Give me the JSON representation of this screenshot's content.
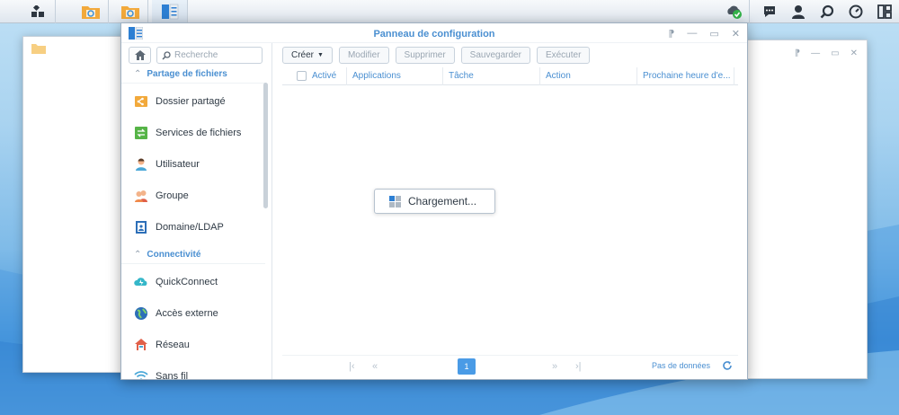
{
  "window": {
    "title": "Panneau de configuration"
  },
  "sidebar": {
    "search_placeholder": "Recherche",
    "sections": [
      {
        "label": "Partage de fichiers"
      },
      {
        "label": "Connectivité"
      }
    ],
    "items": [
      {
        "label": "Dossier partagé",
        "icon": "shared-folder-icon"
      },
      {
        "label": "Services de fichiers",
        "icon": "file-services-icon"
      },
      {
        "label": "Utilisateur",
        "icon": "user-icon"
      },
      {
        "label": "Groupe",
        "icon": "group-icon"
      },
      {
        "label": "Domaine/LDAP",
        "icon": "domain-ldap-icon"
      },
      {
        "label": "QuickConnect",
        "icon": "quickconnect-icon"
      },
      {
        "label": "Accès externe",
        "icon": "external-access-icon"
      },
      {
        "label": "Réseau",
        "icon": "network-icon"
      },
      {
        "label": "Sans fil",
        "icon": "wireless-icon"
      }
    ]
  },
  "toolbar": {
    "create": "Créer",
    "modify": "Modifier",
    "delete": "Supprimer",
    "save": "Sauvegarder",
    "run": "Exécuter"
  },
  "grid": {
    "columns": [
      "Activé",
      "Applications",
      "Tâche",
      "Action",
      "Prochaine heure d'e..."
    ]
  },
  "loading": {
    "text": "Chargement..."
  },
  "pager": {
    "current_page": "1",
    "status": "Pas de données"
  },
  "colors": {
    "accent": "#4a8fd1",
    "page_active": "#4a9be6"
  }
}
